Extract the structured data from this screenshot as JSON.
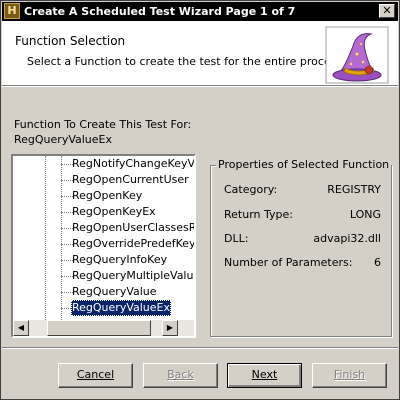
{
  "window": {
    "title": "Create A Scheduled Test Wizard Page 1 of 7",
    "app_icon_glyph": "H",
    "close_glyph": "✕"
  },
  "header": {
    "title": "Function Selection",
    "subtitle": "Select a Function to create the test for the entire process",
    "image_icon": "wizard-hat-icon"
  },
  "function": {
    "label": "Function To Create This Test For:",
    "value": "RegQueryValueEx"
  },
  "function_list": {
    "items": [
      "RegNotifyChangeKeyValue",
      "RegOpenCurrentUser",
      "RegOpenKey",
      "RegOpenKeyEx",
      "RegOpenUserClassesRoot",
      "RegOverridePredefKey",
      "RegQueryInfoKey",
      "RegQueryMultipleValues",
      "RegQueryValue",
      "RegQueryValueEx"
    ],
    "selected": "RegQueryValueEx",
    "scroll_up": "▲",
    "scroll_down": "▼",
    "scroll_left": "◀",
    "scroll_right": "▶"
  },
  "properties": {
    "group_title": "Properties of Selected Function",
    "rows": [
      {
        "label": "Category:",
        "value": "REGISTRY"
      },
      {
        "label": "Return Type:",
        "value": "LONG"
      },
      {
        "label": "DLL:",
        "value": "advapi32.dll"
      },
      {
        "label": "Number of Parameters:",
        "value": "6"
      }
    ]
  },
  "buttons": {
    "cancel": "Cancel",
    "back": "Back",
    "next": "Next",
    "finish": "Finish"
  },
  "colors": {
    "titlebar": "#000000",
    "selection": "#0a246a",
    "face": "#d4d0c8"
  }
}
